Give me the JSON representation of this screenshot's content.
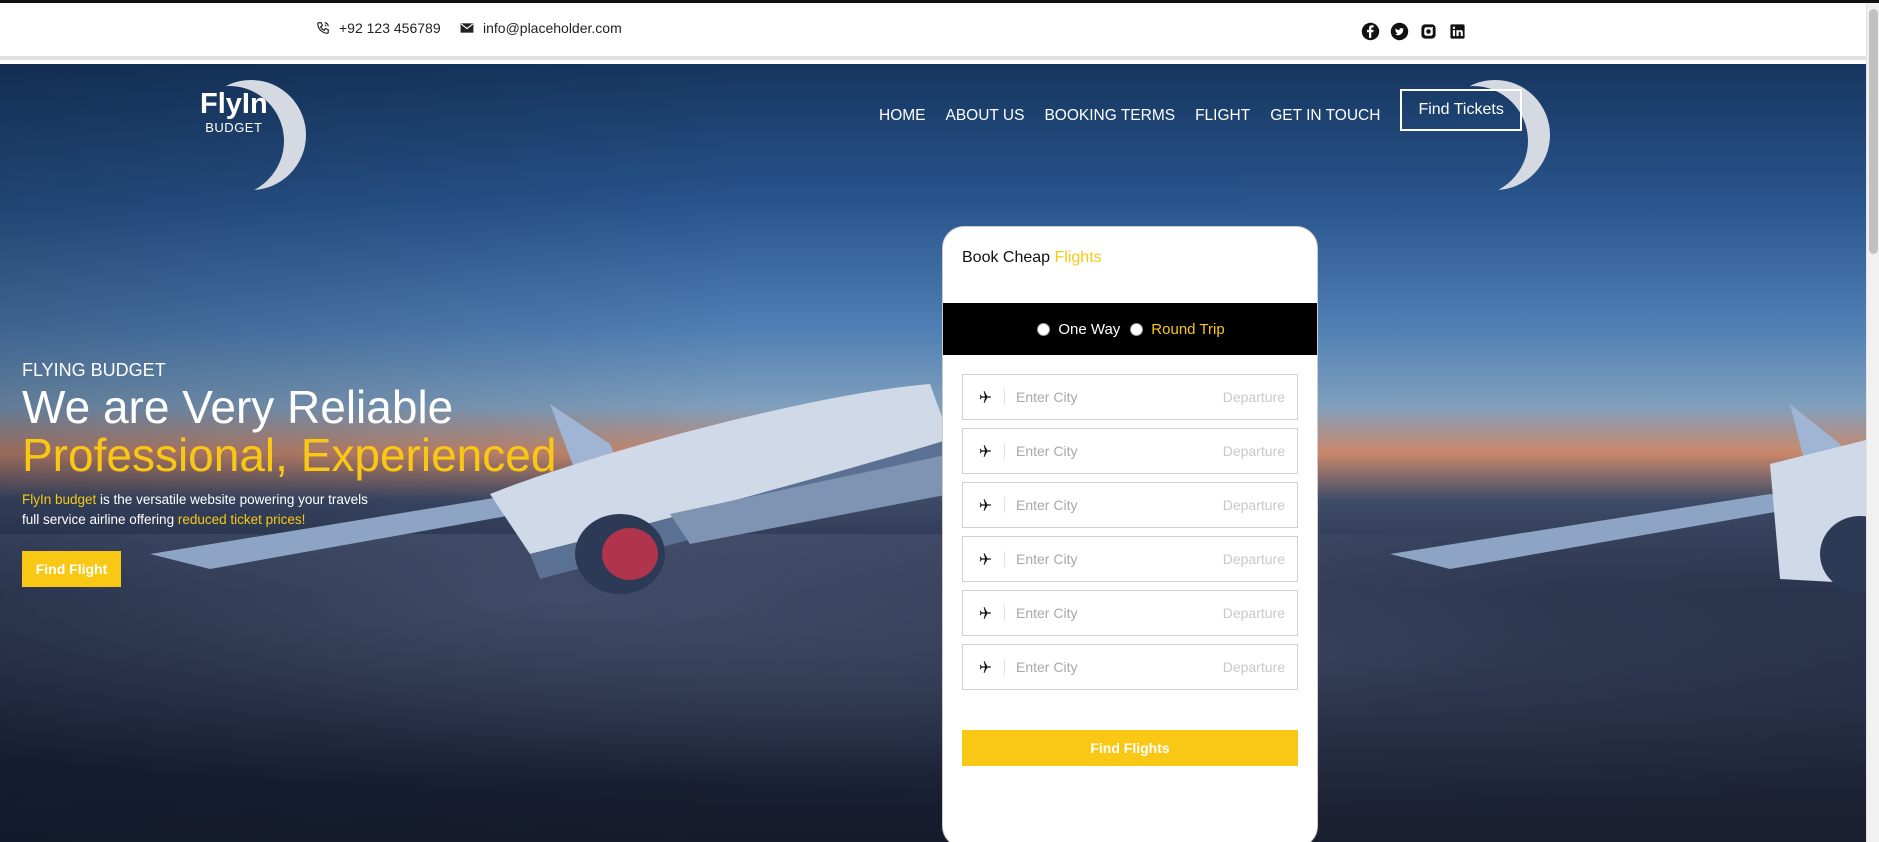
{
  "topbar": {
    "phone": "+92 123 456789",
    "email": "info@placeholder.com",
    "icons": [
      "phone-icon",
      "mail-icon"
    ],
    "socials": [
      "facebook-icon",
      "twitter-icon",
      "instagram-icon",
      "linkedin-icon"
    ]
  },
  "logo": {
    "title": "FlyIn",
    "subtitle": "BUDGET"
  },
  "nav": {
    "items": [
      "HOME",
      "ABOUT US",
      "BOOKING TERMS",
      "FLIGHT",
      "GET IN TOUCH"
    ],
    "button": "Find Tickets"
  },
  "hero": {
    "eyebrow": "FLYING BUDGET",
    "headline_1": "We are Very Reliable",
    "headline_2": "Professional, Experienced",
    "desc_brand": "FlyIn budget",
    "desc_text_1": " is the versatile website powering your travels",
    "desc_text_2": "full service airline offering ",
    "desc_highlight": "reduced ticket prices!",
    "cta": "Find Flight"
  },
  "booking": {
    "title_prefix": "Book Cheap ",
    "title_accent": "Flights",
    "trip_options": [
      "One Way",
      "Round Trip"
    ],
    "fields": [
      {
        "placeholder": "Enter City",
        "hint": "Departure"
      },
      {
        "placeholder": "Enter City",
        "hint": "Departure"
      },
      {
        "placeholder": "Enter City",
        "hint": "Departure"
      },
      {
        "placeholder": "Enter City",
        "hint": "Departure"
      },
      {
        "placeholder": "Enter City",
        "hint": "Departure"
      },
      {
        "placeholder": "Enter City",
        "hint": "Departure"
      }
    ],
    "button": "Find Flights"
  },
  "colors": {
    "accent": "#f9c815",
    "dark_bar": "#000000",
    "text": "#222222"
  }
}
